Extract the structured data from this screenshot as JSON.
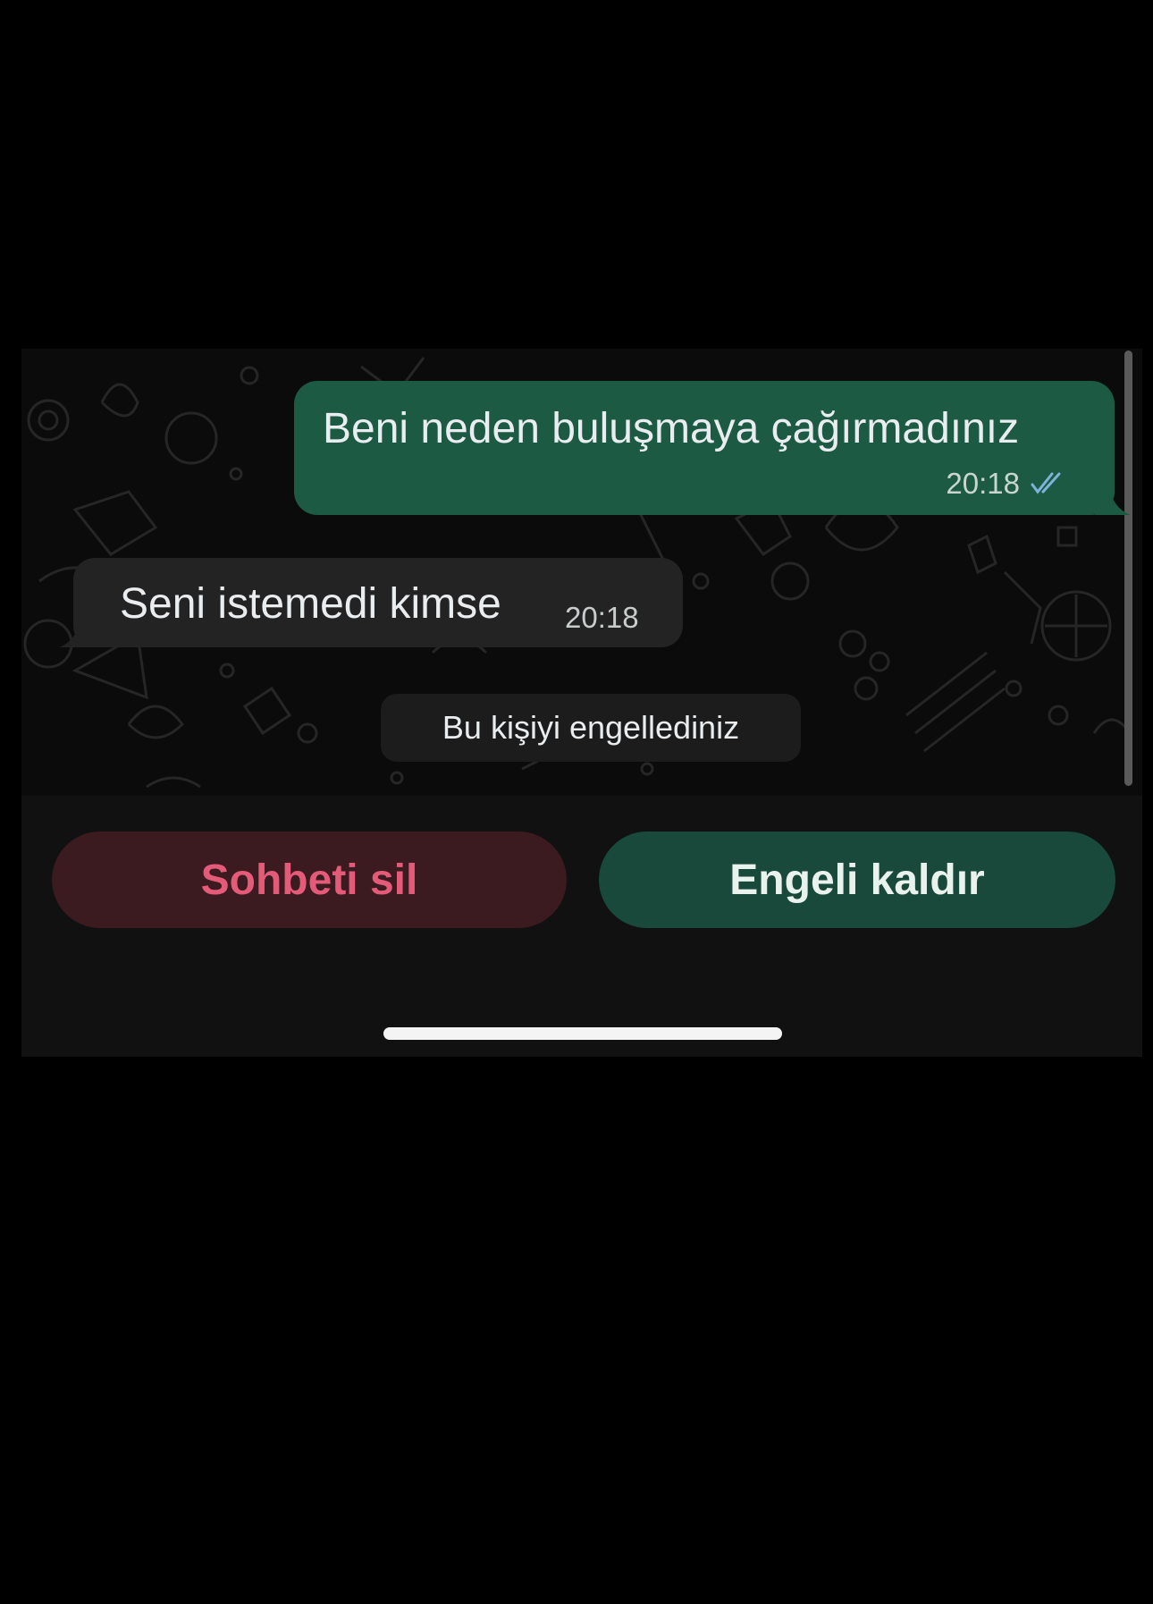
{
  "chat": {
    "outgoing_message": {
      "text": "Beni neden buluşmaya çağırmadınız",
      "time": "20:18",
      "status_icon": "double-check-icon"
    },
    "incoming_message": {
      "text": "Seni istemedi kimse",
      "time": "20:18"
    },
    "system_notice": "Bu kişiyi engellediniz"
  },
  "actions": {
    "delete_label": "Sohbeti sil",
    "unblock_label": "Engeli kaldır"
  },
  "colors": {
    "outgoing_bubble": "#1c5a44",
    "incoming_bubble": "#232323",
    "delete_text": "#e45a79",
    "unblock_button": "#19493a"
  }
}
